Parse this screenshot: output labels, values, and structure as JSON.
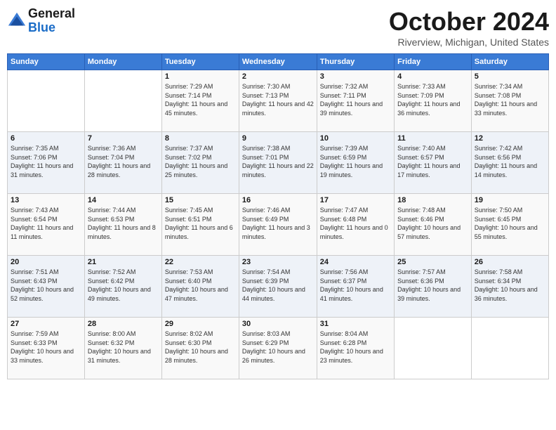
{
  "header": {
    "logo_general": "General",
    "logo_blue": "Blue",
    "month_title": "October 2024",
    "location": "Riverview, Michigan, United States"
  },
  "weekdays": [
    "Sunday",
    "Monday",
    "Tuesday",
    "Wednesday",
    "Thursday",
    "Friday",
    "Saturday"
  ],
  "weeks": [
    [
      {
        "day": "",
        "sunrise": "",
        "sunset": "",
        "daylight": ""
      },
      {
        "day": "",
        "sunrise": "",
        "sunset": "",
        "daylight": ""
      },
      {
        "day": "1",
        "sunrise": "Sunrise: 7:29 AM",
        "sunset": "Sunset: 7:14 PM",
        "daylight": "Daylight: 11 hours and 45 minutes."
      },
      {
        "day": "2",
        "sunrise": "Sunrise: 7:30 AM",
        "sunset": "Sunset: 7:13 PM",
        "daylight": "Daylight: 11 hours and 42 minutes."
      },
      {
        "day": "3",
        "sunrise": "Sunrise: 7:32 AM",
        "sunset": "Sunset: 7:11 PM",
        "daylight": "Daylight: 11 hours and 39 minutes."
      },
      {
        "day": "4",
        "sunrise": "Sunrise: 7:33 AM",
        "sunset": "Sunset: 7:09 PM",
        "daylight": "Daylight: 11 hours and 36 minutes."
      },
      {
        "day": "5",
        "sunrise": "Sunrise: 7:34 AM",
        "sunset": "Sunset: 7:08 PM",
        "daylight": "Daylight: 11 hours and 33 minutes."
      }
    ],
    [
      {
        "day": "6",
        "sunrise": "Sunrise: 7:35 AM",
        "sunset": "Sunset: 7:06 PM",
        "daylight": "Daylight: 11 hours and 31 minutes."
      },
      {
        "day": "7",
        "sunrise": "Sunrise: 7:36 AM",
        "sunset": "Sunset: 7:04 PM",
        "daylight": "Daylight: 11 hours and 28 minutes."
      },
      {
        "day": "8",
        "sunrise": "Sunrise: 7:37 AM",
        "sunset": "Sunset: 7:02 PM",
        "daylight": "Daylight: 11 hours and 25 minutes."
      },
      {
        "day": "9",
        "sunrise": "Sunrise: 7:38 AM",
        "sunset": "Sunset: 7:01 PM",
        "daylight": "Daylight: 11 hours and 22 minutes."
      },
      {
        "day": "10",
        "sunrise": "Sunrise: 7:39 AM",
        "sunset": "Sunset: 6:59 PM",
        "daylight": "Daylight: 11 hours and 19 minutes."
      },
      {
        "day": "11",
        "sunrise": "Sunrise: 7:40 AM",
        "sunset": "Sunset: 6:57 PM",
        "daylight": "Daylight: 11 hours and 17 minutes."
      },
      {
        "day": "12",
        "sunrise": "Sunrise: 7:42 AM",
        "sunset": "Sunset: 6:56 PM",
        "daylight": "Daylight: 11 hours and 14 minutes."
      }
    ],
    [
      {
        "day": "13",
        "sunrise": "Sunrise: 7:43 AM",
        "sunset": "Sunset: 6:54 PM",
        "daylight": "Daylight: 11 hours and 11 minutes."
      },
      {
        "day": "14",
        "sunrise": "Sunrise: 7:44 AM",
        "sunset": "Sunset: 6:53 PM",
        "daylight": "Daylight: 11 hours and 8 minutes."
      },
      {
        "day": "15",
        "sunrise": "Sunrise: 7:45 AM",
        "sunset": "Sunset: 6:51 PM",
        "daylight": "Daylight: 11 hours and 6 minutes."
      },
      {
        "day": "16",
        "sunrise": "Sunrise: 7:46 AM",
        "sunset": "Sunset: 6:49 PM",
        "daylight": "Daylight: 11 hours and 3 minutes."
      },
      {
        "day": "17",
        "sunrise": "Sunrise: 7:47 AM",
        "sunset": "Sunset: 6:48 PM",
        "daylight": "Daylight: 11 hours and 0 minutes."
      },
      {
        "day": "18",
        "sunrise": "Sunrise: 7:48 AM",
        "sunset": "Sunset: 6:46 PM",
        "daylight": "Daylight: 10 hours and 57 minutes."
      },
      {
        "day": "19",
        "sunrise": "Sunrise: 7:50 AM",
        "sunset": "Sunset: 6:45 PM",
        "daylight": "Daylight: 10 hours and 55 minutes."
      }
    ],
    [
      {
        "day": "20",
        "sunrise": "Sunrise: 7:51 AM",
        "sunset": "Sunset: 6:43 PM",
        "daylight": "Daylight: 10 hours and 52 minutes."
      },
      {
        "day": "21",
        "sunrise": "Sunrise: 7:52 AM",
        "sunset": "Sunset: 6:42 PM",
        "daylight": "Daylight: 10 hours and 49 minutes."
      },
      {
        "day": "22",
        "sunrise": "Sunrise: 7:53 AM",
        "sunset": "Sunset: 6:40 PM",
        "daylight": "Daylight: 10 hours and 47 minutes."
      },
      {
        "day": "23",
        "sunrise": "Sunrise: 7:54 AM",
        "sunset": "Sunset: 6:39 PM",
        "daylight": "Daylight: 10 hours and 44 minutes."
      },
      {
        "day": "24",
        "sunrise": "Sunrise: 7:56 AM",
        "sunset": "Sunset: 6:37 PM",
        "daylight": "Daylight: 10 hours and 41 minutes."
      },
      {
        "day": "25",
        "sunrise": "Sunrise: 7:57 AM",
        "sunset": "Sunset: 6:36 PM",
        "daylight": "Daylight: 10 hours and 39 minutes."
      },
      {
        "day": "26",
        "sunrise": "Sunrise: 7:58 AM",
        "sunset": "Sunset: 6:34 PM",
        "daylight": "Daylight: 10 hours and 36 minutes."
      }
    ],
    [
      {
        "day": "27",
        "sunrise": "Sunrise: 7:59 AM",
        "sunset": "Sunset: 6:33 PM",
        "daylight": "Daylight: 10 hours and 33 minutes."
      },
      {
        "day": "28",
        "sunrise": "Sunrise: 8:00 AM",
        "sunset": "Sunset: 6:32 PM",
        "daylight": "Daylight: 10 hours and 31 minutes."
      },
      {
        "day": "29",
        "sunrise": "Sunrise: 8:02 AM",
        "sunset": "Sunset: 6:30 PM",
        "daylight": "Daylight: 10 hours and 28 minutes."
      },
      {
        "day": "30",
        "sunrise": "Sunrise: 8:03 AM",
        "sunset": "Sunset: 6:29 PM",
        "daylight": "Daylight: 10 hours and 26 minutes."
      },
      {
        "day": "31",
        "sunrise": "Sunrise: 8:04 AM",
        "sunset": "Sunset: 6:28 PM",
        "daylight": "Daylight: 10 hours and 23 minutes."
      },
      {
        "day": "",
        "sunrise": "",
        "sunset": "",
        "daylight": ""
      },
      {
        "day": "",
        "sunrise": "",
        "sunset": "",
        "daylight": ""
      }
    ]
  ]
}
